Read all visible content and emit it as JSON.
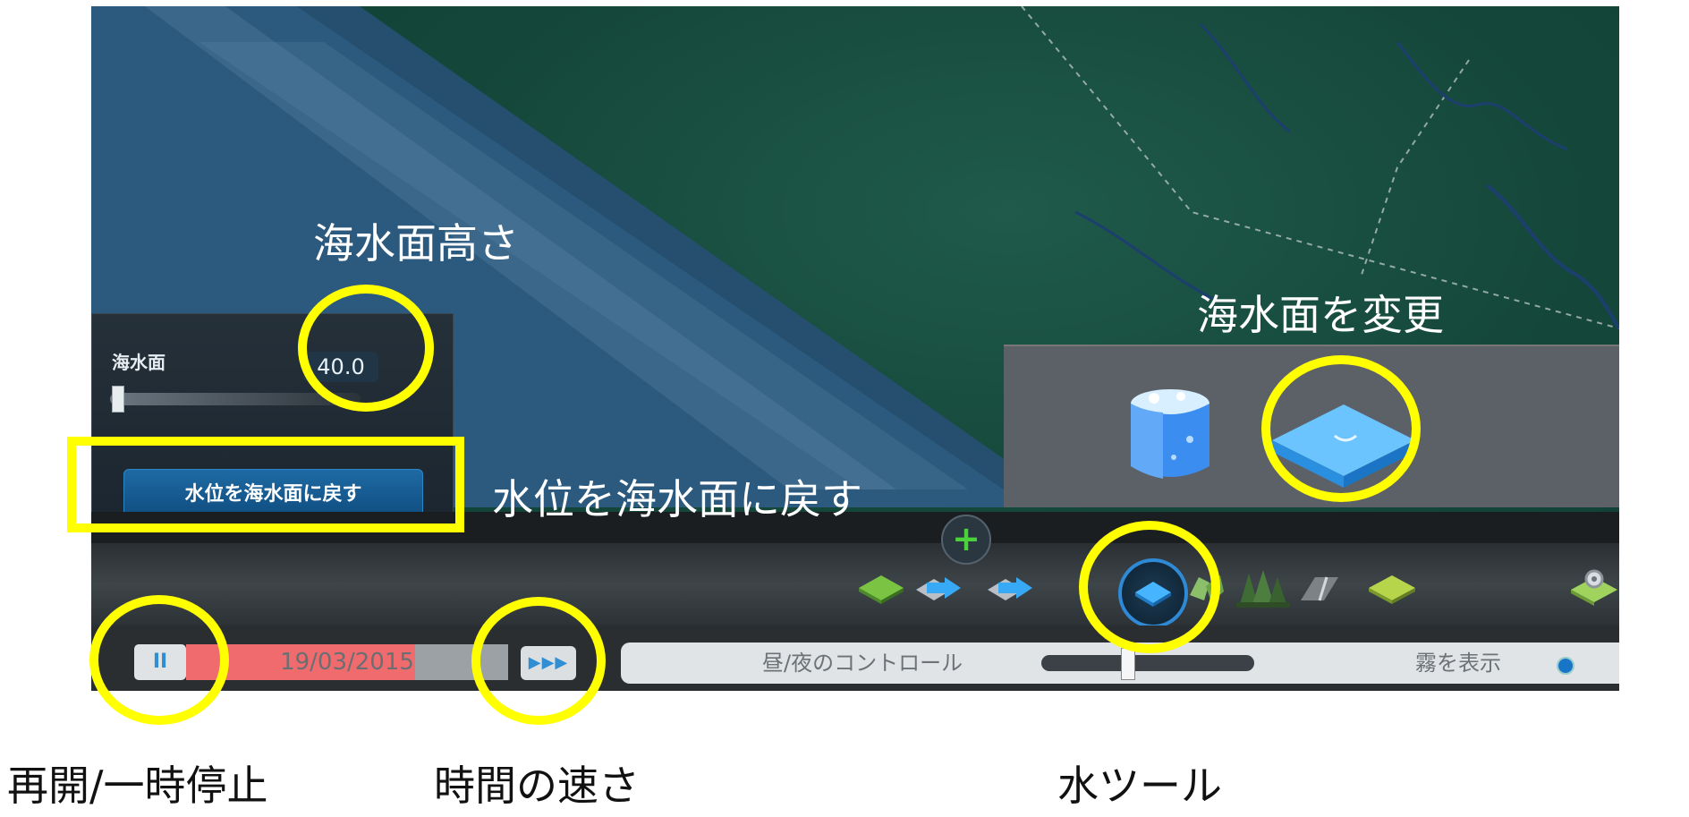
{
  "sea_panel": {
    "label": "海水面",
    "value": "40.0",
    "slider_level": 0.02,
    "reset_button_label": "水位を海水面に戻す"
  },
  "toolbar": {
    "add_symbol": "+",
    "tools": [
      "terrain-tool-icon",
      "level-up-tool-icon",
      "level-down-tool-icon",
      "water-tool-icon",
      "tree-tool-icon",
      "forest-tool-icon",
      "road-tool-icon",
      "grass-tool-icon",
      "settings-gear-icon"
    ],
    "selected_tool": "water-tool-icon"
  },
  "water_panel": {
    "options": [
      "water-source-icon",
      "sea-level-icon"
    ]
  },
  "bottom_bar": {
    "pause_symbol": "II",
    "date": "19/03/2015",
    "speed_symbol": "▶▶▶",
    "day_night_label": "昼/夜のコントロール",
    "fog_label": "霧を表示"
  },
  "annotations": {
    "sea_level_height": "海水面高さ",
    "change_sea_level": "海水面を変更",
    "reset_water": "水位を海水面に戻す",
    "resume_pause": "再開/一時停止",
    "time_speed": "時間の速さ",
    "water_tool": "水ツール"
  },
  "colors": {
    "highlight": "#ffff00",
    "accent_blue": "#2f8ad6",
    "date_fill": "#f06b6e"
  }
}
